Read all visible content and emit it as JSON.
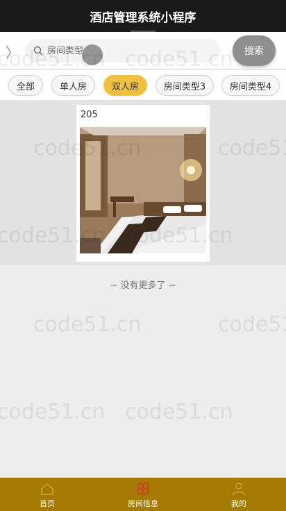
{
  "app": {
    "title": "酒店管理系统小程序"
  },
  "search": {
    "placeholder": "房间类型",
    "button_label": "搜索"
  },
  "filters": [
    "全部",
    "单人房",
    "双人房",
    "房间类型3",
    "房间类型4"
  ],
  "active_filter_index": 2,
  "rooms": [
    {
      "number": "205"
    }
  ],
  "list_footer": "~ 没有更多了 ~",
  "tabs": [
    {
      "label": "首页",
      "icon": "home-icon"
    },
    {
      "label": "房间信息",
      "icon": "room-info-icon"
    },
    {
      "label": "我的",
      "icon": "user-icon"
    }
  ],
  "watermark_text": "code51.cn",
  "colors": {
    "accent": "#f0c040",
    "tabbar": "#a57a00",
    "title_bar": "#1a1a1a"
  }
}
